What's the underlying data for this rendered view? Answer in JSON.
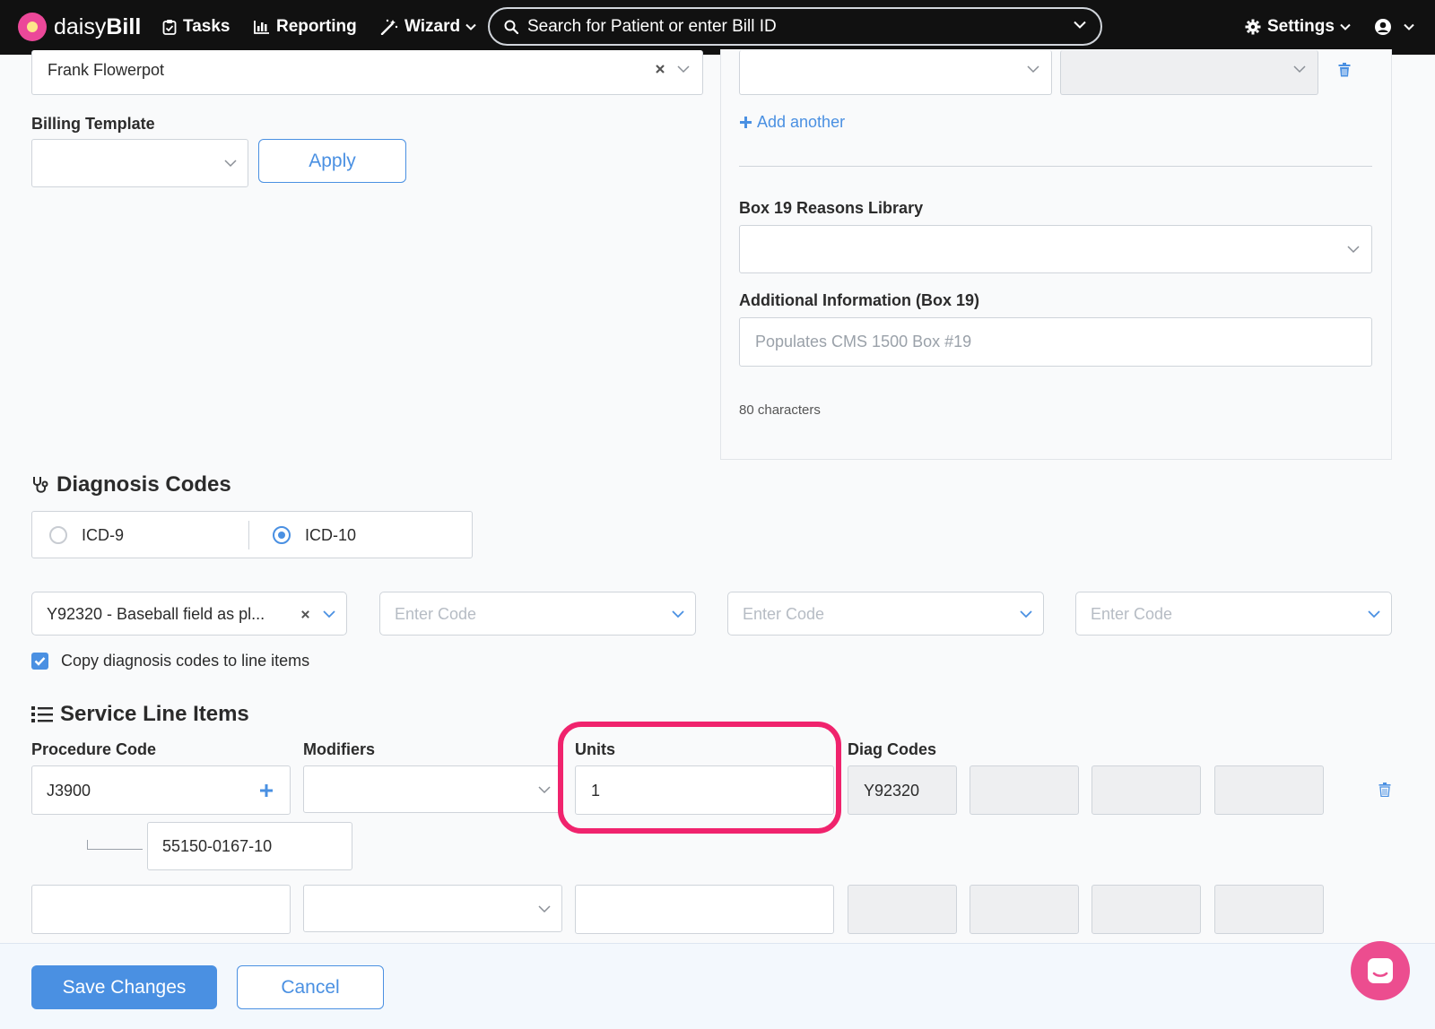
{
  "nav": {
    "brand_light": "daisy",
    "brand_bold": "Bill",
    "tasks": "Tasks",
    "reporting": "Reporting",
    "wizard": "Wizard",
    "search_placeholder": "Search for Patient or enter Bill ID",
    "settings": "Settings"
  },
  "left_form": {
    "provider_value": "Frank Flowerpot",
    "billing_template_label": "Billing Template",
    "billing_template_value": "",
    "apply_label": "Apply"
  },
  "right_panel": {
    "add_another_label": "Add another",
    "box19_library_label": "Box 19 Reasons Library",
    "box19_library_value": "",
    "additional_info_label": "Additional Information (Box 19)",
    "additional_info_placeholder": "Populates CMS 1500 Box #19",
    "char_count": "80 characters"
  },
  "diagnosis": {
    "heading": "Diagnosis Codes",
    "icd9_label": "ICD-9",
    "icd10_label": "ICD-10",
    "selected_version": "ICD-10",
    "code_1": "Y92320 - Baseball field as pl...",
    "code_placeholder": "Enter Code",
    "copy_label": "Copy diagnosis codes to line items",
    "copy_checked": true
  },
  "service_lines": {
    "heading": "Service Line Items",
    "col_procedure": "Procedure Code",
    "col_modifiers": "Modifiers",
    "col_units": "Units",
    "col_diag": "Diag Codes",
    "row1": {
      "procedure": "J3900",
      "units": "1",
      "diag_1": "Y92320",
      "ndc": "55150-0167-10"
    }
  },
  "footer": {
    "save_label": "Save Changes",
    "cancel_label": "Cancel"
  },
  "colors": {
    "accent": "#4a90e2",
    "highlight": "#f0236d",
    "nav_bg": "#111111"
  }
}
